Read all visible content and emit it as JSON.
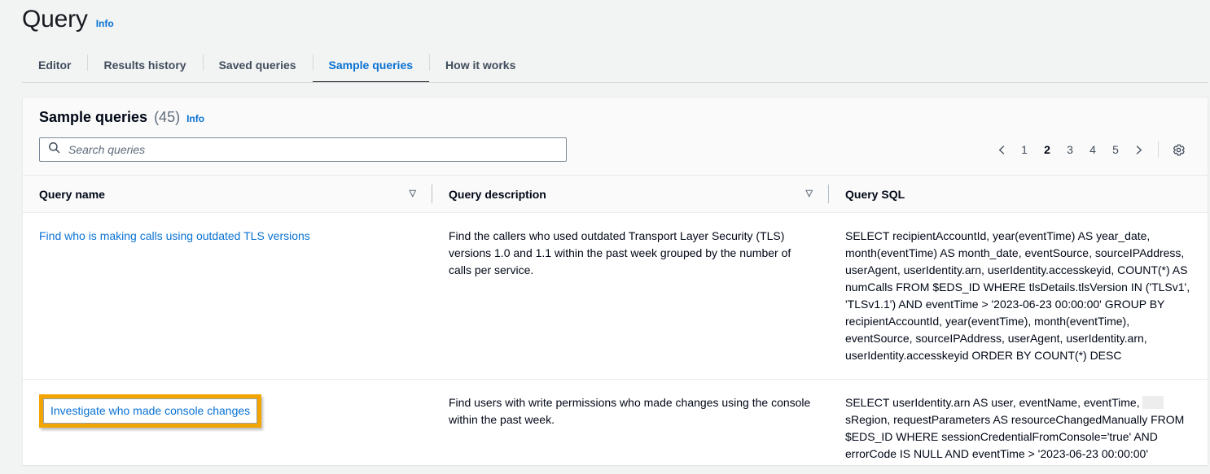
{
  "header": {
    "title": "Query",
    "info_label": "Info"
  },
  "tabs": [
    {
      "label": "Editor",
      "active": false
    },
    {
      "label": "Results history",
      "active": false
    },
    {
      "label": "Saved queries",
      "active": false
    },
    {
      "label": "Sample queries",
      "active": true
    },
    {
      "label": "How it works",
      "active": false
    }
  ],
  "panel": {
    "title": "Sample queries",
    "count": "(45)",
    "info_label": "Info"
  },
  "search": {
    "placeholder": "Search queries",
    "value": "",
    "icon": "search-icon"
  },
  "pagination": {
    "prev_icon": "chevron-left-icon",
    "next_icon": "chevron-right-icon",
    "pages": [
      "1",
      "2",
      "3",
      "4",
      "5"
    ],
    "current": "2",
    "settings_icon": "gear-icon"
  },
  "table": {
    "columns": [
      {
        "label": "Query name",
        "sort_icon": "sort-descending-icon"
      },
      {
        "label": "Query description",
        "sort_icon": "sort-descending-icon"
      },
      {
        "label": "Query SQL",
        "sort_icon": ""
      }
    ],
    "rows": [
      {
        "name": "Find who is making calls using outdated TLS versions",
        "highlighted": false,
        "description": "Find the callers who used outdated Transport Layer Security (TLS) versions 1.0 and 1.1 within the past week grouped by the number of calls per service.",
        "sql_before": "SELECT recipientAccountId, year(eventTime) AS year_date, month(eventTime) AS month_date, eventSource, sourceIPAddress, userAgent, userIdentity.arn, userIdentity.accesskeyid, COUNT(*) AS numCalls FROM $EDS_ID WHERE tlsDetails.tlsVersion IN ('TLSv1', 'TLSv1.1') AND eventTime > '2023-06-23 00:00:00' GROUP BY recipientAccountId, year(eventTime), month(eventTime), eventSource, sourceIPAddress, userAgent, userIdentity.arn, userIdentity.accesskeyid ORDER BY COUNT(*) DESC",
        "sql_after": "",
        "redacted": false
      },
      {
        "name": "Investigate who made console changes",
        "highlighted": true,
        "description": "Find users with write permissions who made changes using the console within the past week.",
        "sql_before": "SELECT userIdentity.arn AS user, eventName, eventTime,",
        "sql_after": "sRegion, requestParameters AS resourceChangedManually FROM $EDS_ID WHERE sessionCredentialFromConsole='true' AND errorCode IS NULL AND eventTime > '2023-06-23 00:00:00'",
        "redacted": true
      }
    ]
  },
  "colors": {
    "link": "#0972d3",
    "page_bg": "#f2f3f3",
    "highlight": "#f2a401",
    "tab_active_underline": "#16191f"
  }
}
